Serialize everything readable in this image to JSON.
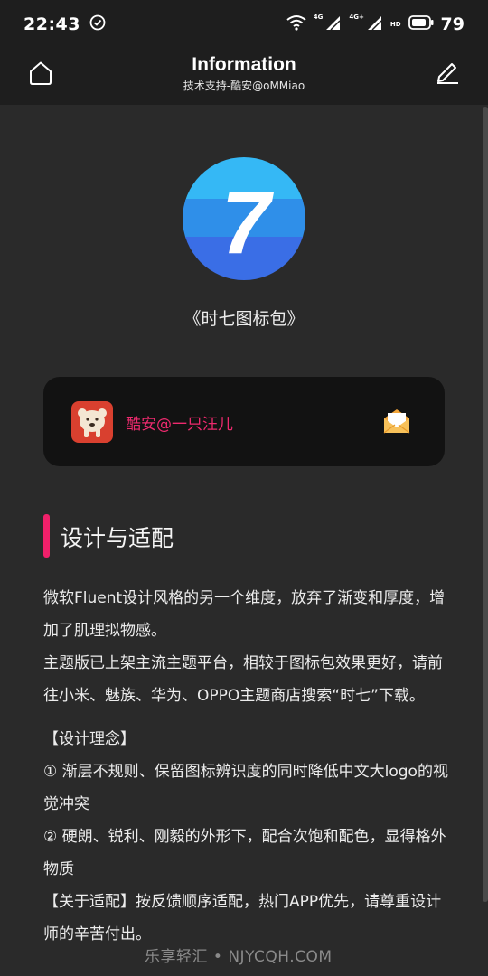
{
  "status_bar": {
    "time": "22:43",
    "network_1": "4G",
    "network_2": "4G+",
    "hd_label": "HD",
    "battery": "79"
  },
  "app_bar": {
    "title": "Information",
    "subtitle": "技术支持-酷安@oMMiao",
    "home_icon": "home-icon",
    "edit_icon": "edit-icon"
  },
  "logo": {
    "glyph": "7",
    "colors": [
      "#35b8f5",
      "#2f8fe9",
      "#3a6ee6"
    ]
  },
  "pack_title": "《时七图标包》",
  "author": {
    "name": "酷安@一只汪儿",
    "name_color": "#ee2a6e",
    "mail_icon": "mail-icon"
  },
  "section": {
    "title": "设计与适配",
    "accent": "#f0206a"
  },
  "body": {
    "p1": "微软Fluent设计风格的另一个维度，放弃了渐变和厚度，增加了肌理拟物感。",
    "p2": "主题版已上架主流主题平台，相较于图标包效果更好，请前往小米、魅族、华为、OPPO主题商店搜索“时七”下载。",
    "p3": "【设计理念】",
    "p4": "① 渐层不规则、保留图标辨识度的同时降低中文大logo的视觉冲突",
    "p5": "② 硬朗、锐利、刚毅的外形下，配合次饱和配色，显得格外物质",
    "p6": "【关于适配】按反馈顺序适配，热门APP优先，请尊重设计师的辛苦付出。"
  },
  "watermark": "乐享轻汇 • NJYCQH.COM"
}
